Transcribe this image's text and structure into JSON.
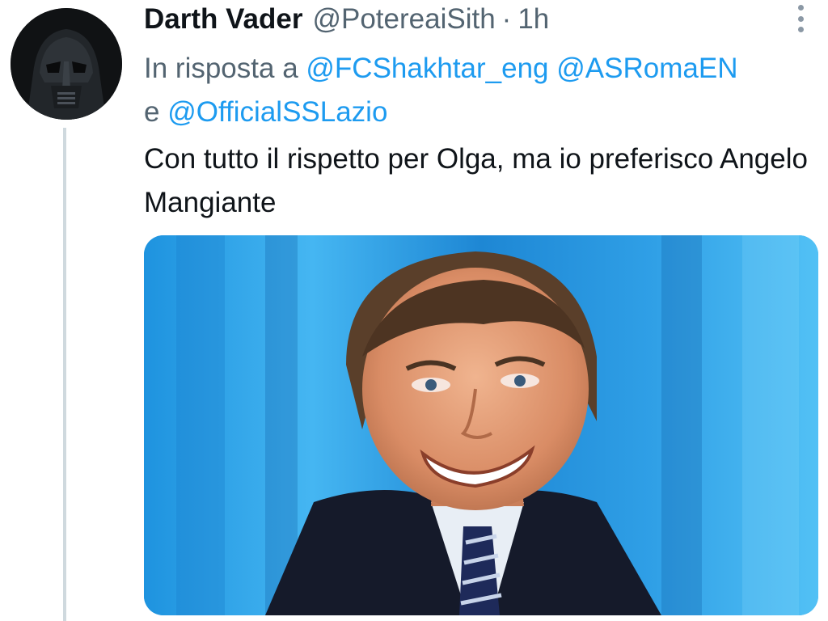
{
  "tweet": {
    "author_name": "Darth Vader",
    "author_handle": "@PotereaiSith",
    "separator": "·",
    "time": "1h",
    "reply_prefix": "In risposta a",
    "mentions": [
      "@FCShakhtar_eng",
      "@ASRomaEN",
      "@OfficialSSLazio"
    ],
    "mention_joiner": "e",
    "text": "Con tutto il rispetto per Olga, ma io preferisco Angelo Mangiante"
  },
  "icons": {
    "more": "more-options-icon",
    "avatar": "darth-vader-helmet"
  },
  "colors": {
    "link": "#1d9bf0",
    "secondary_text": "#536471",
    "primary_text": "#0f1419",
    "thread_line": "#cfd9de"
  }
}
